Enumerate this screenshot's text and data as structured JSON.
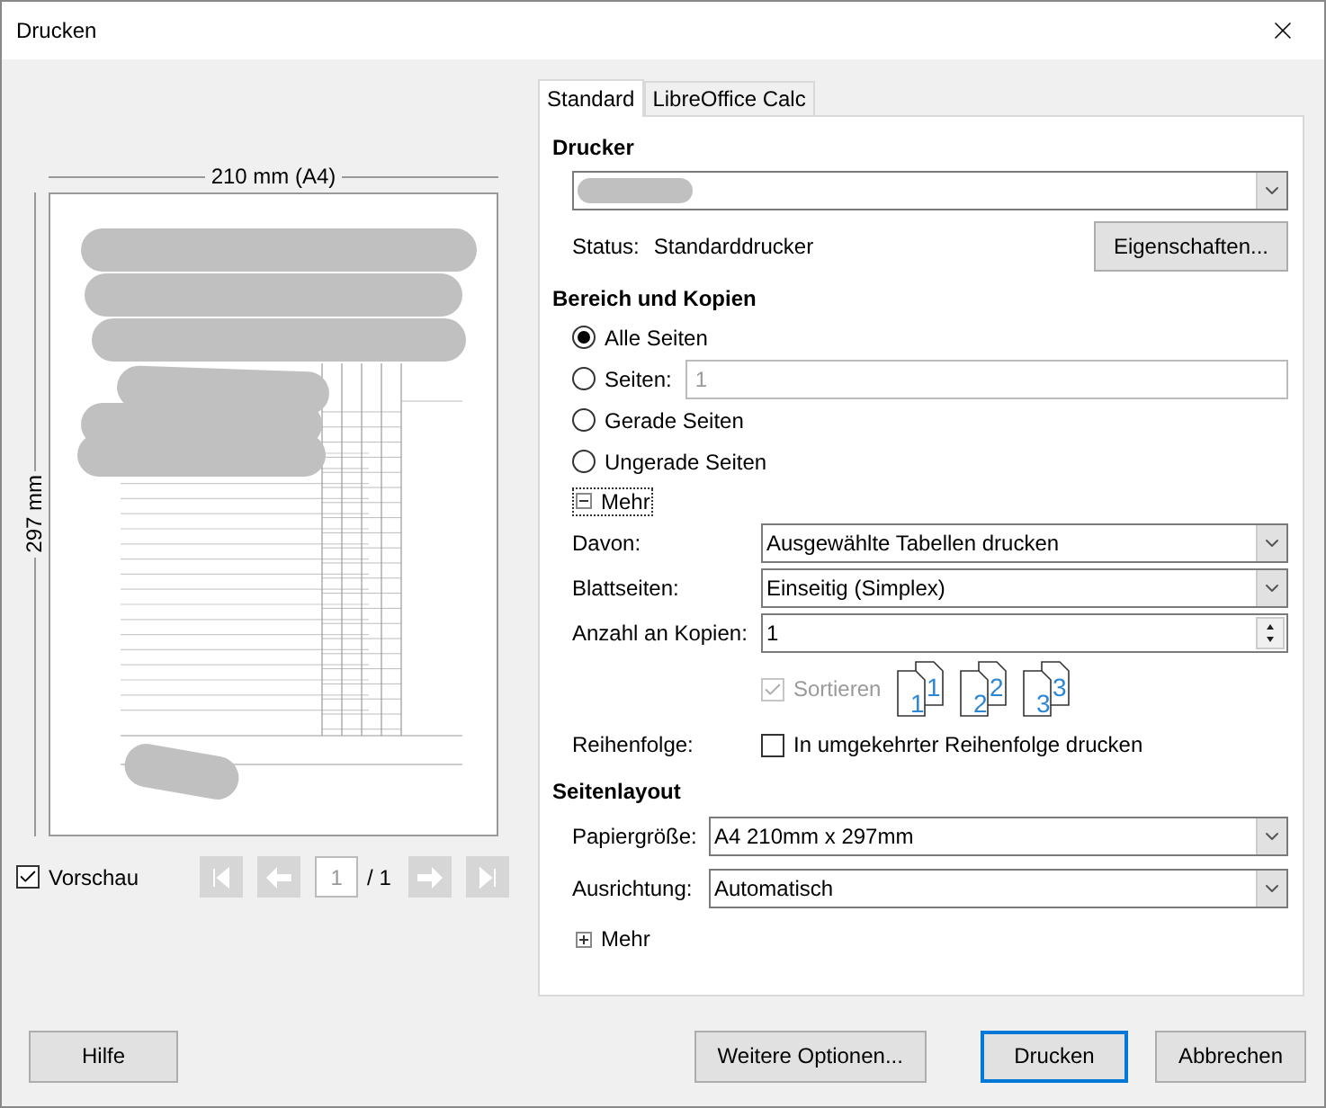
{
  "window": {
    "title": "Drucken"
  },
  "preview": {
    "width_label": "210 mm (A4)",
    "height_label": "297 mm"
  },
  "preview_controls": {
    "show_preview": {
      "label": "Vorschau",
      "checked": true
    },
    "page": "1",
    "page_total": "/ 1"
  },
  "tabs": [
    {
      "label": "Standard",
      "selected": true
    },
    {
      "label": "LibreOffice Calc",
      "selected": false
    }
  ],
  "printer": {
    "heading": "Drucker",
    "status_label": "Status:",
    "status": "Standarddrucker",
    "properties_button": "Eigenschaften..."
  },
  "range": {
    "heading": "Bereich und Kopien",
    "options": [
      {
        "label": "Alle Seiten",
        "selected": true
      },
      {
        "label": "Seiten:",
        "selected": false,
        "field": "1"
      },
      {
        "label": "Gerade Seiten",
        "selected": false
      },
      {
        "label": "Ungerade Seiten",
        "selected": false
      }
    ],
    "more": {
      "label": "Mehr",
      "expanded": true
    },
    "fields": [
      {
        "kind": "dropdown",
        "label": "Davon:",
        "value": "Ausgewählte Tabellen drucken"
      },
      {
        "kind": "dropdown",
        "label": "Blattseiten:",
        "value": "Einseitig (Simplex)"
      },
      {
        "kind": "spin",
        "label": "Anzahl an Kopien:",
        "value": "1"
      }
    ],
    "collate": {
      "label": "Sortieren",
      "checked": true,
      "disabled": true,
      "pages": [
        {
          "front": "1",
          "back": "1"
        },
        {
          "front": "2",
          "back": "2"
        },
        {
          "front": "3",
          "back": "3"
        }
      ]
    },
    "order": {
      "label": "Reihenfolge:",
      "option": "In umgekehrter Reihenfolge drucken",
      "checked": false
    }
  },
  "layout": {
    "heading": "Seitenlayout",
    "fields": [
      {
        "kind": "dropdown",
        "label": "Papiergröße:",
        "value": "A4 210mm x 297mm"
      },
      {
        "kind": "dropdown",
        "label": "Ausrichtung:",
        "value": "Automatisch"
      }
    ],
    "more": {
      "label": "Mehr",
      "expanded": false
    }
  },
  "buttons": [
    {
      "label": "Hilfe",
      "default": false
    },
    {
      "label": "Weitere Optionen...",
      "default": false
    },
    {
      "label": "Drucken",
      "default": true
    },
    {
      "label": "Abbrechen",
      "default": false
    }
  ]
}
